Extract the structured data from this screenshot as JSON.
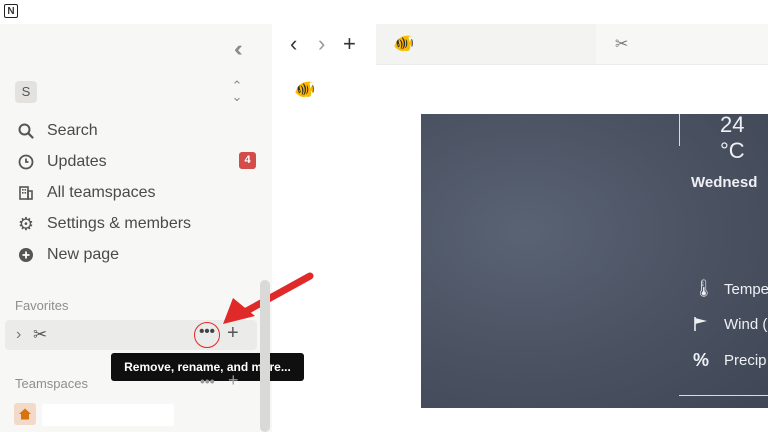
{
  "app": {
    "logo": "N"
  },
  "sidebar": {
    "workspace_initial": "S",
    "nav_items": [
      {
        "label": "Search",
        "icon": "search-icon"
      },
      {
        "label": "Updates",
        "icon": "clock-icon",
        "badge": "4"
      },
      {
        "label": "All teamspaces",
        "icon": "building-icon"
      },
      {
        "label": "Settings & members",
        "icon": "gear-icon"
      },
      {
        "label": "New page",
        "icon": "plus-circle-icon"
      }
    ],
    "favorites_label": "Favorites",
    "teamspaces_label": "Teamspaces",
    "tooltip": "Remove, rename, and more...",
    "more_button": "•••"
  },
  "weather": {
    "temperature": "24 °C",
    "day": "Wednesd",
    "rows": [
      {
        "icon": "thermometer-icon",
        "label": "Tempe"
      },
      {
        "icon": "wind-flag-icon",
        "label": "Wind ("
      },
      {
        "icon": "percent-icon",
        "label": "Precip"
      }
    ]
  },
  "colors": {
    "accent_red": "#e02a2a",
    "badge_red": "#d44c47"
  }
}
